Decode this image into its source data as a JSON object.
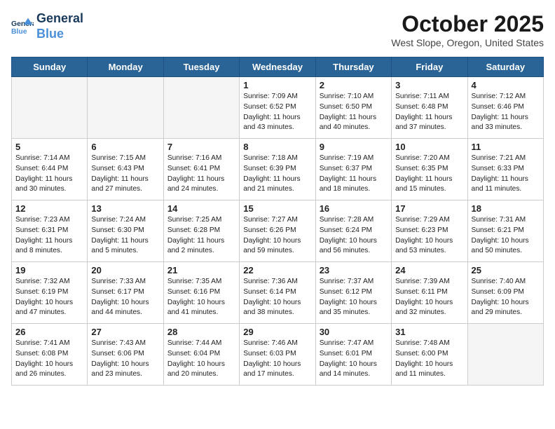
{
  "header": {
    "logo_line1": "General",
    "logo_line2": "Blue",
    "month": "October 2025",
    "location": "West Slope, Oregon, United States"
  },
  "weekdays": [
    "Sunday",
    "Monday",
    "Tuesday",
    "Wednesday",
    "Thursday",
    "Friday",
    "Saturday"
  ],
  "weeks": [
    [
      {
        "day": "",
        "empty": true
      },
      {
        "day": "",
        "empty": true
      },
      {
        "day": "",
        "empty": true
      },
      {
        "day": "1",
        "sunrise": "7:09 AM",
        "sunset": "6:52 PM",
        "daylight": "11 hours and 43 minutes."
      },
      {
        "day": "2",
        "sunrise": "7:10 AM",
        "sunset": "6:50 PM",
        "daylight": "11 hours and 40 minutes."
      },
      {
        "day": "3",
        "sunrise": "7:11 AM",
        "sunset": "6:48 PM",
        "daylight": "11 hours and 37 minutes."
      },
      {
        "day": "4",
        "sunrise": "7:12 AM",
        "sunset": "6:46 PM",
        "daylight": "11 hours and 33 minutes."
      }
    ],
    [
      {
        "day": "5",
        "sunrise": "7:14 AM",
        "sunset": "6:44 PM",
        "daylight": "11 hours and 30 minutes."
      },
      {
        "day": "6",
        "sunrise": "7:15 AM",
        "sunset": "6:43 PM",
        "daylight": "11 hours and 27 minutes."
      },
      {
        "day": "7",
        "sunrise": "7:16 AM",
        "sunset": "6:41 PM",
        "daylight": "11 hours and 24 minutes."
      },
      {
        "day": "8",
        "sunrise": "7:18 AM",
        "sunset": "6:39 PM",
        "daylight": "11 hours and 21 minutes."
      },
      {
        "day": "9",
        "sunrise": "7:19 AM",
        "sunset": "6:37 PM",
        "daylight": "11 hours and 18 minutes."
      },
      {
        "day": "10",
        "sunrise": "7:20 AM",
        "sunset": "6:35 PM",
        "daylight": "11 hours and 15 minutes."
      },
      {
        "day": "11",
        "sunrise": "7:21 AM",
        "sunset": "6:33 PM",
        "daylight": "11 hours and 11 minutes."
      }
    ],
    [
      {
        "day": "12",
        "sunrise": "7:23 AM",
        "sunset": "6:31 PM",
        "daylight": "11 hours and 8 minutes."
      },
      {
        "day": "13",
        "sunrise": "7:24 AM",
        "sunset": "6:30 PM",
        "daylight": "11 hours and 5 minutes."
      },
      {
        "day": "14",
        "sunrise": "7:25 AM",
        "sunset": "6:28 PM",
        "daylight": "11 hours and 2 minutes."
      },
      {
        "day": "15",
        "sunrise": "7:27 AM",
        "sunset": "6:26 PM",
        "daylight": "10 hours and 59 minutes."
      },
      {
        "day": "16",
        "sunrise": "7:28 AM",
        "sunset": "6:24 PM",
        "daylight": "10 hours and 56 minutes."
      },
      {
        "day": "17",
        "sunrise": "7:29 AM",
        "sunset": "6:23 PM",
        "daylight": "10 hours and 53 minutes."
      },
      {
        "day": "18",
        "sunrise": "7:31 AM",
        "sunset": "6:21 PM",
        "daylight": "10 hours and 50 minutes."
      }
    ],
    [
      {
        "day": "19",
        "sunrise": "7:32 AM",
        "sunset": "6:19 PM",
        "daylight": "10 hours and 47 minutes."
      },
      {
        "day": "20",
        "sunrise": "7:33 AM",
        "sunset": "6:17 PM",
        "daylight": "10 hours and 44 minutes."
      },
      {
        "day": "21",
        "sunrise": "7:35 AM",
        "sunset": "6:16 PM",
        "daylight": "10 hours and 41 minutes."
      },
      {
        "day": "22",
        "sunrise": "7:36 AM",
        "sunset": "6:14 PM",
        "daylight": "10 hours and 38 minutes."
      },
      {
        "day": "23",
        "sunrise": "7:37 AM",
        "sunset": "6:12 PM",
        "daylight": "10 hours and 35 minutes."
      },
      {
        "day": "24",
        "sunrise": "7:39 AM",
        "sunset": "6:11 PM",
        "daylight": "10 hours and 32 minutes."
      },
      {
        "day": "25",
        "sunrise": "7:40 AM",
        "sunset": "6:09 PM",
        "daylight": "10 hours and 29 minutes."
      }
    ],
    [
      {
        "day": "26",
        "sunrise": "7:41 AM",
        "sunset": "6:08 PM",
        "daylight": "10 hours and 26 minutes."
      },
      {
        "day": "27",
        "sunrise": "7:43 AM",
        "sunset": "6:06 PM",
        "daylight": "10 hours and 23 minutes."
      },
      {
        "day": "28",
        "sunrise": "7:44 AM",
        "sunset": "6:04 PM",
        "daylight": "10 hours and 20 minutes."
      },
      {
        "day": "29",
        "sunrise": "7:46 AM",
        "sunset": "6:03 PM",
        "daylight": "10 hours and 17 minutes."
      },
      {
        "day": "30",
        "sunrise": "7:47 AM",
        "sunset": "6:01 PM",
        "daylight": "10 hours and 14 minutes."
      },
      {
        "day": "31",
        "sunrise": "7:48 AM",
        "sunset": "6:00 PM",
        "daylight": "10 hours and 11 minutes."
      },
      {
        "day": "",
        "empty": true
      }
    ]
  ],
  "labels": {
    "sunrise": "Sunrise:",
    "sunset": "Sunset:",
    "daylight": "Daylight:"
  }
}
